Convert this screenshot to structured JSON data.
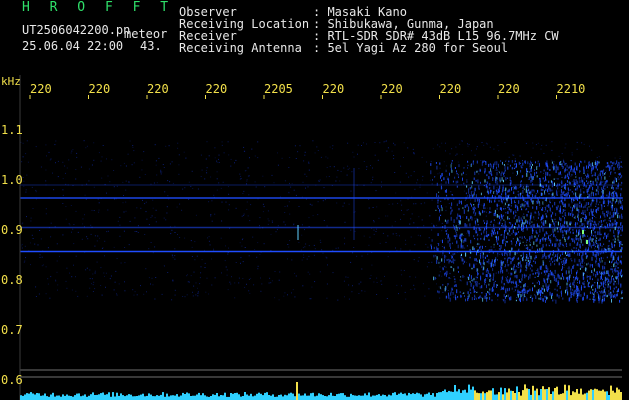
{
  "header": {
    "brand": "H R O F F T",
    "filename": "UT2506042200.pn",
    "mode": "meteor",
    "datetime": "25.06.04 22:00",
    "value": "43.",
    "labels": {
      "observer": "Observer",
      "location": "Receiving Location",
      "receiver": "Receiver",
      "antenna": "Receiving Antenna"
    },
    "values": {
      "observer": ": Masaki Kano",
      "location": ": Shibukawa, Gunma, Japan",
      "receiver": ": RTL-SDR SDR# 43dB L15 96.7MHz CW",
      "antenna": ": 5el Yagi Az 280 for Seoul"
    }
  },
  "axes": {
    "y_unit": "kHz",
    "time_ticks": [
      "220",
      "220",
      "220",
      "220",
      "2205",
      "220",
      "220",
      "220",
      "220",
      "2210"
    ],
    "freq_ticks": [
      "1.1",
      "1.0",
      "0.9",
      "0.8",
      "0.7",
      "0.6"
    ]
  },
  "colors": {
    "background": "#000000",
    "signal": "#1f4dff",
    "signal_hot": "#5fd0ff",
    "grid": "#6f6f6f",
    "tick_label": "#f2e04a",
    "bottom_spectrum": "#2fd0ff"
  }
}
